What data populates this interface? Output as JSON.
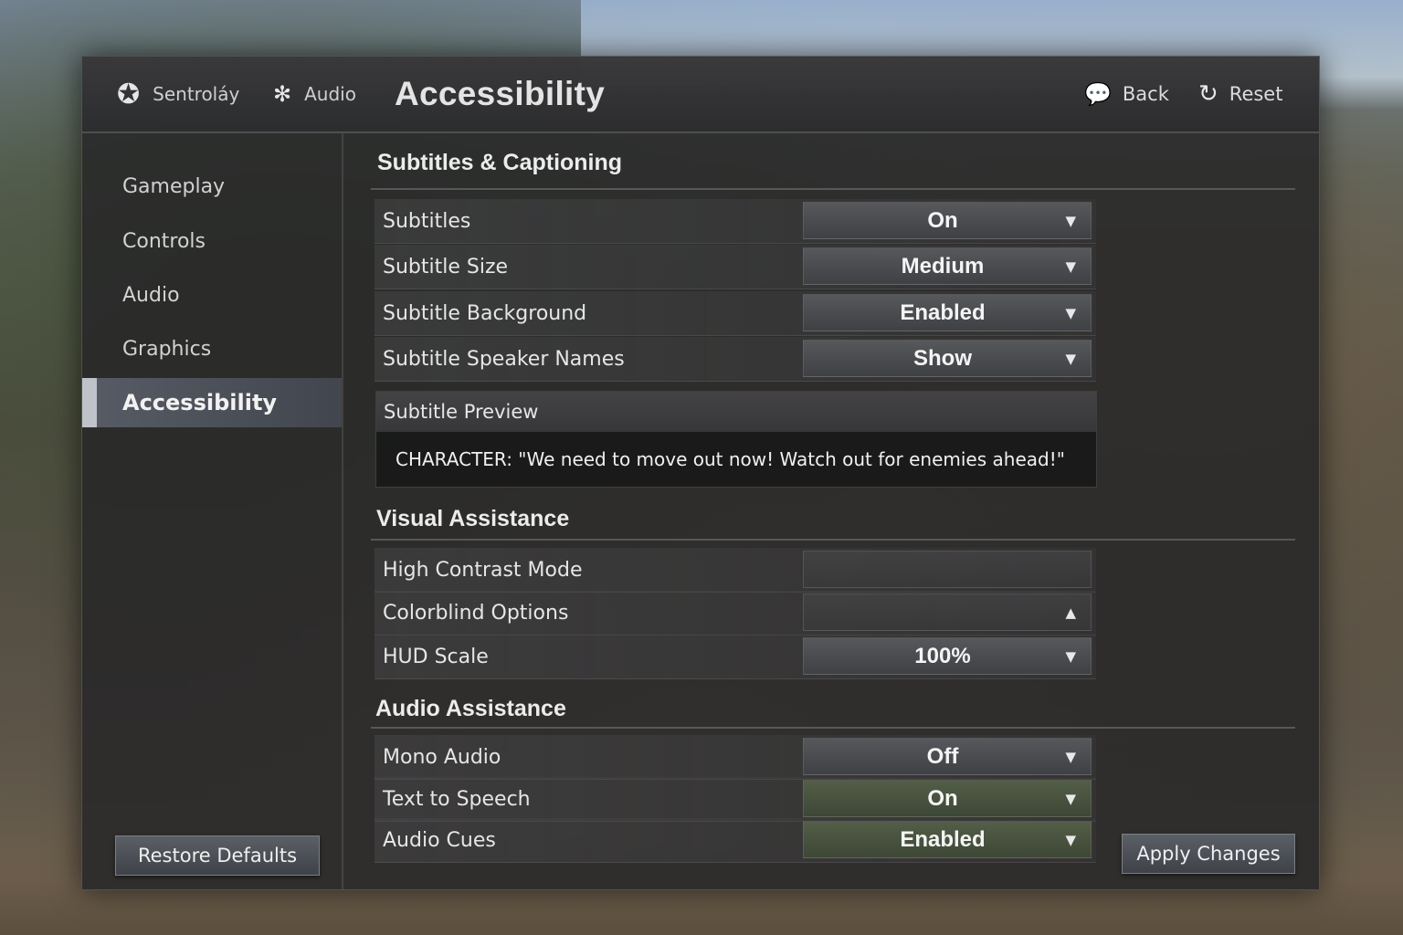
{
  "header": {
    "crumb1": "Sentroláy",
    "crumb2": "Audio",
    "title": "Accessibility",
    "back_label": "Back",
    "reset_label": "Reset"
  },
  "sidebar": {
    "items": [
      {
        "label": "Gameplay"
      },
      {
        "label": "Controls"
      },
      {
        "label": "Audio"
      },
      {
        "label": "Graphics"
      },
      {
        "label": "Accessibility"
      }
    ],
    "active": "Accessibility",
    "restore_label": "Restore Defaults"
  },
  "subtitles": {
    "heading": "Subtitles & Captioning",
    "rows": [
      {
        "label": "Subtitles",
        "value": "On"
      },
      {
        "label": "Subtitle Size",
        "value": "Medium"
      },
      {
        "label": "Subtitle Background",
        "value": "Enabled"
      },
      {
        "label": "Subtitle Speaker Names",
        "value": "Show"
      }
    ],
    "preview_heading": "Subtitle Preview",
    "preview_text": "CHARACTER: \"We need to move out now! Watch out for enemies ahead!\""
  },
  "visual": {
    "heading": "Visual Assistance",
    "rows": [
      {
        "label": "High Contrast Mode",
        "value": ""
      },
      {
        "label": "Colorblind Options",
        "value": ""
      },
      {
        "label": "HUD Scale",
        "value": "100%"
      }
    ]
  },
  "audio": {
    "heading": "Audio Assistance",
    "rows": [
      {
        "label": "Mono Audio",
        "value": "Off"
      },
      {
        "label": "Text to Speech",
        "value": "On"
      },
      {
        "label": "Audio Cues",
        "value": "Enabled"
      }
    ]
  },
  "footer": {
    "apply_label": "Apply Changes"
  },
  "icons": {
    "logo": "gear-cog-icon",
    "audio_crumb": "gear-icon",
    "back": "speech-bubbles-icon",
    "reset": "refresh-icon",
    "dropdown_down": "triangle-down-icon",
    "dropdown_up": "triangle-up-icon"
  },
  "colors": {
    "active_dropdown_green": "#546048",
    "panel_bg": "#262628"
  }
}
